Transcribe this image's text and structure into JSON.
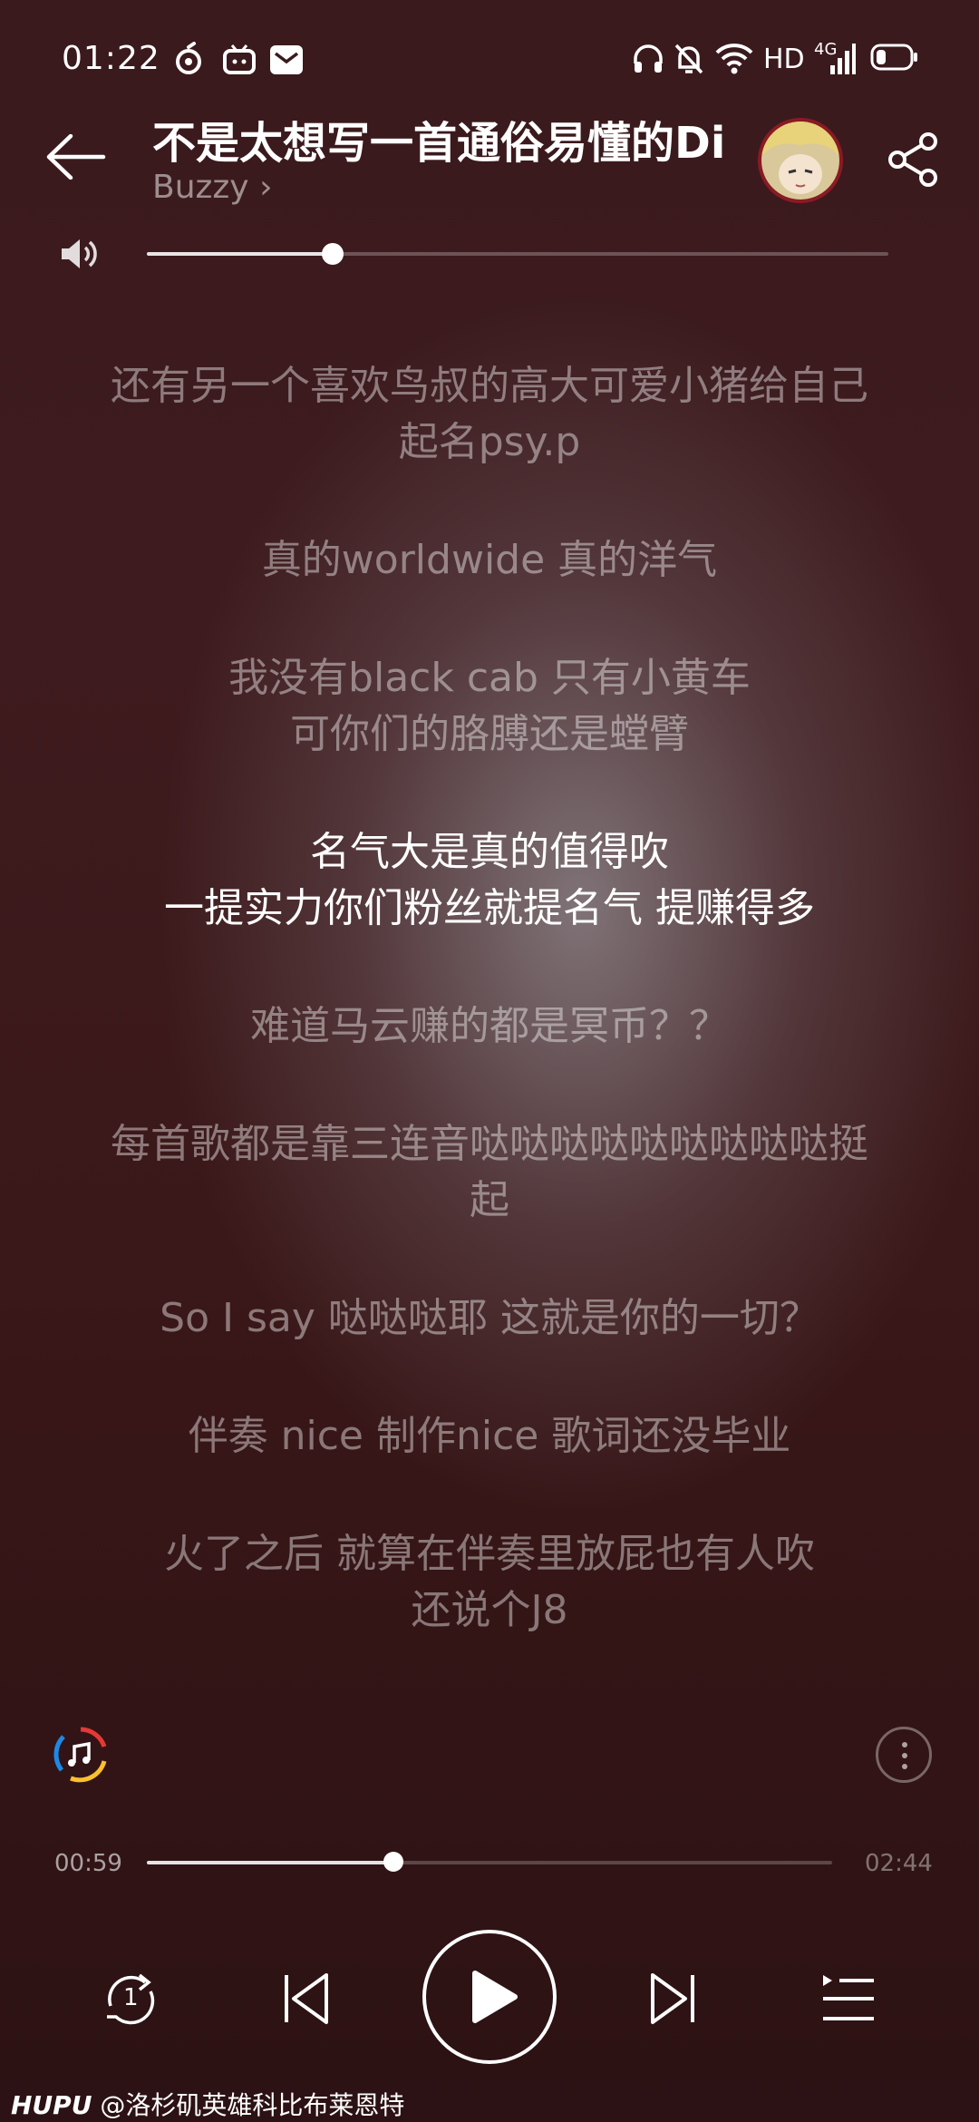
{
  "status_bar": {
    "time": "01:22",
    "network_label": "HD",
    "network_type": "4G"
  },
  "header": {
    "song_title": "不是太想写一首通俗易懂的Di",
    "artist": "Buzzy",
    "artist_chevron": "›"
  },
  "volume": {
    "level": 0.25
  },
  "lyrics": [
    {
      "lines": [
        "还有另一个喜欢鸟叔的高大可爱小猪给自己",
        "起名psy.p"
      ],
      "active": false
    },
    {
      "lines": [
        "真的worldwide 真的洋气"
      ],
      "active": false
    },
    {
      "lines": [
        "我没有black cab 只有小黄车",
        "可你们的胳膊还是螳臂"
      ],
      "active": false
    },
    {
      "lines": [
        "名气大是真的值得吹",
        "一提实力你们粉丝就提名气 提赚得多"
      ],
      "active": true
    },
    {
      "lines": [
        "难道马云赚的都是冥币？？"
      ],
      "active": false
    },
    {
      "lines": [
        "每首歌都是靠三连音哒哒哒哒哒哒哒哒哒挺",
        "起"
      ],
      "active": false
    },
    {
      "lines": [
        "So I say 哒哒哒耶 这就是你的一切？"
      ],
      "active": false
    },
    {
      "lines": [
        "伴奏 nice 制作nice 歌词还没毕业"
      ],
      "active": false
    },
    {
      "lines": [
        "火了之后 就算在伴奏里放屁也有人吹",
        "还说个J8"
      ],
      "active": false
    }
  ],
  "player": {
    "current_time": "00:59",
    "total_time": "02:44",
    "progress": 0.36,
    "repeat_mode_number": "1"
  },
  "watermark": {
    "brand": "HUPU",
    "user": "@洛杉矶英雄科比布莱恩特"
  },
  "colors": {
    "accent_red": "#e53935",
    "accent_blue": "#1e88e5",
    "accent_yellow": "#fbc02d"
  },
  "icons": [
    "back-arrow-icon",
    "share-icon",
    "speaker-icon",
    "music-badge-icon",
    "more-icon",
    "repeat-one-icon",
    "previous-icon",
    "play-icon",
    "next-icon",
    "playlist-icon"
  ]
}
